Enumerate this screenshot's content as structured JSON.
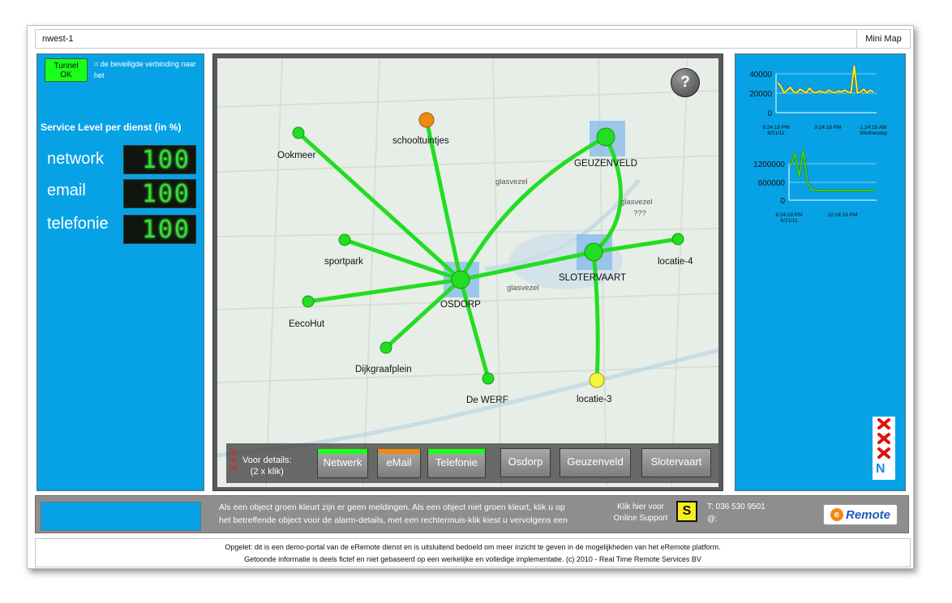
{
  "header": {
    "title": "nwest-1",
    "minimap_label": "Mini Map"
  },
  "left_panel": {
    "tunnel_label_line1": "Tunnel",
    "tunnel_label_line2": "OK",
    "tunnel_note": "= de beveiligde verbinding naar het",
    "service_level_title": "Service Level per dienst  (in %)",
    "services": [
      {
        "label": "network",
        "value": "100"
      },
      {
        "label": "email",
        "value": "100"
      },
      {
        "label": "telefonie",
        "value": "100"
      }
    ]
  },
  "map": {
    "nodes": [
      {
        "label": "Ookmeer",
        "status": "green"
      },
      {
        "label": "schooltuintjes",
        "status": "orange"
      },
      {
        "label": "GEUZENVELD",
        "status": "green"
      },
      {
        "label": "sportpark",
        "status": "green"
      },
      {
        "label": "SLOTERVAART",
        "status": "green"
      },
      {
        "label": "locatie-4",
        "status": "green"
      },
      {
        "label": "OSDORP",
        "status": "green"
      },
      {
        "label": "EecoHut",
        "status": "green"
      },
      {
        "label": "Dijkgraafplein",
        "status": "green"
      },
      {
        "label": "De WERF",
        "status": "green"
      },
      {
        "label": "locatie-3",
        "status": "yellow"
      }
    ],
    "link_labels": {
      "glasvezel_1": "glasvezel",
      "glasvezel_2": "glasvezel",
      "glasvezel_3": "glasvezel",
      "unknown": "???"
    },
    "help_label": "?",
    "details_line1": "Voor details:",
    "details_line2": "(2 x klik)",
    "buttons": [
      {
        "label": "Netwerk",
        "status_color": "#1aff1a"
      },
      {
        "label": "eMail",
        "status_color": "#f08a12"
      },
      {
        "label": "Telefonie",
        "status_color": "#1aff1a"
      },
      {
        "label": "Osdorp",
        "status_color": ""
      },
      {
        "label": "Geuzenveld",
        "status_color": ""
      },
      {
        "label": "Slotervaart",
        "status_color": ""
      }
    ]
  },
  "right_panel": {
    "chart1": {
      "y_ticks": [
        "40000",
        "20000",
        "0"
      ],
      "x_ticks": [
        "6:24:18 PM",
        "9:24:18 PM",
        "1:24:18 AM"
      ],
      "x_subticks": [
        "6/21/11",
        "Wednesday"
      ]
    },
    "chart2": {
      "y_ticks": [
        "1200000",
        "600000",
        "0"
      ],
      "x_ticks": [
        "6:24:18 PM",
        "10:24:18 PM"
      ],
      "x_subticks": [
        "6/21/11"
      ]
    },
    "logo_letters": "N"
  },
  "chart_data": [
    {
      "type": "line",
      "title": "",
      "xlabel": "",
      "ylabel": "",
      "ylim": [
        0,
        50000
      ],
      "x": [
        0,
        1,
        2,
        3,
        4,
        5,
        6,
        7,
        8,
        9,
        10,
        11,
        12,
        13,
        14,
        15,
        16,
        17,
        18,
        19,
        20,
        21,
        22,
        23,
        24,
        25,
        26,
        27,
        28,
        29,
        30
      ],
      "series": [
        {
          "values": [
            32000,
            28000,
            21000,
            24000,
            27000,
            22000,
            21000,
            25000,
            23000,
            21000,
            26000,
            22000,
            21000,
            23000,
            22000,
            21000,
            24000,
            22000,
            21000,
            23000,
            22000,
            24000,
            22000,
            21000,
            50000,
            21000,
            22000,
            25000,
            21000,
            24000,
            22000
          ]
        }
      ],
      "grid": true
    },
    {
      "type": "line",
      "title": "",
      "xlabel": "",
      "ylabel": "",
      "ylim": [
        0,
        1500000
      ],
      "x": [
        0,
        1,
        2,
        3,
        4,
        5,
        6,
        7,
        8,
        9,
        10,
        11,
        12,
        13,
        14,
        15,
        16,
        17,
        18,
        19,
        20
      ],
      "series": [
        {
          "values": [
            1000000,
            1400000,
            700000,
            1500000,
            500000,
            320000,
            300000,
            290000,
            290000,
            280000,
            280000,
            290000,
            285000,
            280000,
            290000,
            285000,
            280000,
            290000,
            285000,
            280000,
            285000
          ]
        }
      ],
      "grid": true
    }
  ],
  "footer": {
    "info_line1": "Als een object groen kleurt zijn er geen meldingen. Als een object niet groen kleurt, klik u op",
    "info_line2": "het betreffende object voor de alarm-details, met een rechtermuis-klik kiest u vervolgens een",
    "support_line1": "Klik hier voor",
    "support_line2": "Online Support",
    "support_badge": "S",
    "phone": "T:  036 530 9501",
    "email": "@:",
    "logo_e": "e",
    "logo_text": "Remote"
  },
  "disclaimer": {
    "line1": "Opgelet: dit is een demo-portal van de eRemote dienst en is uitsluitend bedoeld om meer inzicht te geven in de mogelijkheden van het eRemote platform.",
    "line2": "Getoonde informatie is deels fictef en niet gebaseerd op een werkelijke en volledige  implementatie. (c) 2010 -  Real Time Remote Services BV"
  }
}
